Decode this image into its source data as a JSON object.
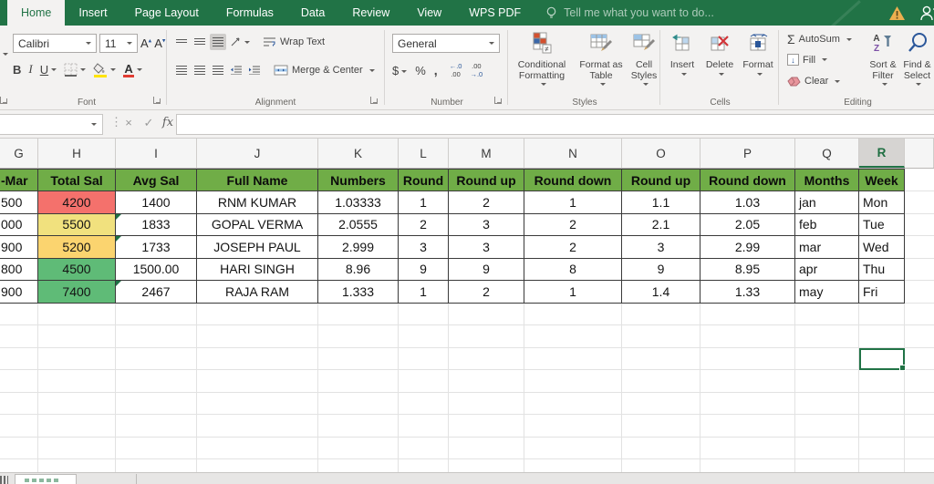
{
  "colors": {
    "brand_green": "#217346",
    "ribbon_bg": "#F3F2F1",
    "grid_line": "#E2E2E2",
    "cell_border": "#3A3A3A",
    "table_header_bg": "#70AD47"
  },
  "tabs": {
    "items": [
      "Home",
      "Insert",
      "Page Layout",
      "Formulas",
      "Data",
      "Review",
      "View",
      "WPS PDF"
    ],
    "active_index": 0,
    "tell_me": "Tell me what you want to do..."
  },
  "ribbon": {
    "font": {
      "family": "Calibri",
      "size": "11",
      "grow": "A",
      "shrink": "A",
      "bold": "B",
      "italic": "I",
      "underline": "U",
      "color_letter": "A",
      "label": "Font"
    },
    "alignment": {
      "wrap": "Wrap Text",
      "merge": "Merge & Center",
      "label": "Alignment"
    },
    "number": {
      "format": "General",
      "currency": "$",
      "percent": "%",
      "comma": ",",
      "inc_top": "←.0",
      "inc_bot": ".00",
      "dec_top": ".00",
      "dec_bot": "→.0",
      "label": "Number"
    },
    "styles": {
      "conditional": "Conditional Formatting",
      "format_table": "Format as Table",
      "cell_styles": "Cell Styles",
      "label": "Styles"
    },
    "cells": {
      "insert": "Insert",
      "delete": "Delete",
      "format": "Format",
      "label": "Cells"
    },
    "editing": {
      "autosum_sigma": "Σ",
      "autosum": "AutoSum",
      "fill": "Fill",
      "clear": "Clear",
      "sort": "Sort & Filter",
      "find": "Find & Select",
      "label": "Editing"
    }
  },
  "formula_bar": {
    "cancel": "×",
    "enter": "✓",
    "fx": "fx"
  },
  "sheet": {
    "selected_column": "R",
    "columns": [
      {
        "letter": "G",
        "width": 42
      },
      {
        "letter": "H",
        "width": 85
      },
      {
        "letter": "I",
        "width": 89
      },
      {
        "letter": "J",
        "width": 133
      },
      {
        "letter": "K",
        "width": 88
      },
      {
        "letter": "L",
        "width": 55
      },
      {
        "letter": "M",
        "width": 83
      },
      {
        "letter": "N",
        "width": 107
      },
      {
        "letter": "O",
        "width": 86
      },
      {
        "letter": "P",
        "width": 104
      },
      {
        "letter": "Q",
        "width": 70
      },
      {
        "letter": "R",
        "width": 50
      },
      {
        "letter": "",
        "width": 32
      }
    ],
    "table": {
      "headers": [
        "-Mar",
        "Total Sal",
        "Avg Sal",
        "Full Name",
        "Numbers",
        "Round",
        "Round up",
        "Round down",
        "Round up",
        "Round down",
        "Months",
        "Week"
      ],
      "rows": [
        [
          "500",
          "4200",
          "1400",
          "RNM KUMAR",
          "1.03333",
          "1",
          "2",
          "1",
          "1.1",
          "1.03",
          "jan",
          "Mon"
        ],
        [
          "000",
          "5500",
          "1833",
          "GOPAL VERMA",
          "2.0555",
          "2",
          "3",
          "2",
          "2.1",
          "2.05",
          "feb",
          "Tue"
        ],
        [
          "900",
          "5200",
          "1733",
          "JOSEPH PAUL",
          "2.999",
          "3",
          "3",
          "2",
          "3",
          "2.99",
          "mar",
          "Wed"
        ],
        [
          "800",
          "4500",
          "1500.00",
          "HARI SINGH",
          "8.96",
          "9",
          "9",
          "8",
          "9",
          "8.95",
          "apr",
          "Thu"
        ],
        [
          "900",
          "7400",
          "2467",
          "RAJA RAM",
          "1.333",
          "1",
          "2",
          "1",
          "1.4",
          "1.33",
          "may",
          "Fri"
        ]
      ],
      "total_sal_fills": [
        "#F4716C",
        "#F1E17E",
        "#FBD46F",
        "#5FBB77",
        "#5FBB77"
      ],
      "error_flag_rows": [
        1,
        2,
        4
      ],
      "left_aligned_columns": [
        10,
        11
      ],
      "header_row_height": 25,
      "data_row_height": 24.5
    },
    "selection": {
      "column": "R",
      "data_row_offset": 7
    }
  }
}
